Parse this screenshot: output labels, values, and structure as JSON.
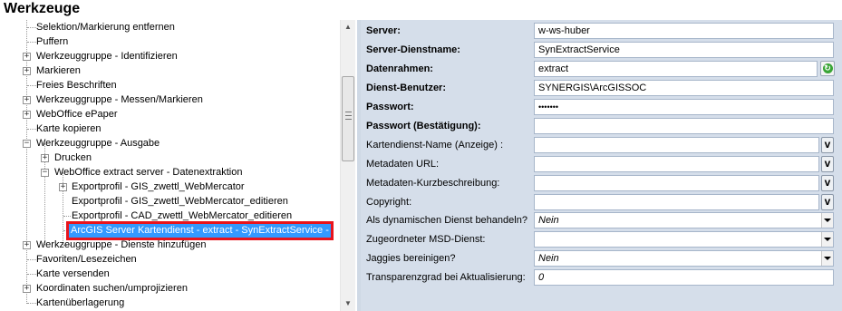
{
  "window": {
    "title": "Werkzeuge"
  },
  "tree": {
    "items": [
      {
        "label": "Selektion/Markierung entfernen",
        "toggle": ""
      },
      {
        "label": "Puffern",
        "toggle": ""
      },
      {
        "label": "Werkzeuggruppe - Identifizieren",
        "toggle": "+"
      },
      {
        "label": "Markieren",
        "toggle": "+"
      },
      {
        "label": "Freies Beschriften",
        "toggle": ""
      },
      {
        "label": "Werkzeuggruppe - Messen/Markieren",
        "toggle": "+"
      },
      {
        "label": "WebOffice ePaper",
        "toggle": "+"
      },
      {
        "label": "Karte kopieren",
        "toggle": ""
      },
      {
        "label": "Werkzeuggruppe - Ausgabe",
        "toggle": "−"
      },
      {
        "label": "Drucken",
        "toggle": "+"
      },
      {
        "label": "WebOffice extract server - Datenextraktion",
        "toggle": "−"
      },
      {
        "label": "Exportprofil - GIS_zwettl_WebMercator",
        "toggle": "+"
      },
      {
        "label": "Exportprofil - GIS_zwettl_WebMercator_editieren",
        "toggle": ""
      },
      {
        "label": "Exportprofil - CAD_zwettl_WebMercator_editieren",
        "toggle": ""
      },
      {
        "label": "ArcGIS Server Kartendienst - extract - SynExtractService -",
        "toggle": ""
      },
      {
        "label": "Werkzeuggruppe - Dienste hinzufügen",
        "toggle": "+"
      },
      {
        "label": "Favoriten/Lesezeichen",
        "toggle": ""
      },
      {
        "label": "Karte versenden",
        "toggle": ""
      },
      {
        "label": "Koordinaten suchen/umprojizieren",
        "toggle": "+"
      },
      {
        "label": "Kartenüberlagerung",
        "toggle": ""
      }
    ]
  },
  "scrollbar": {
    "up": "▲",
    "down": "▼"
  },
  "properties": {
    "rows": [
      {
        "label": "Server:",
        "value": "w-ws-huber",
        "bold": true,
        "control": "none"
      },
      {
        "label": "Server-Dienstname:",
        "value": "SynExtractService",
        "bold": true,
        "control": "none"
      },
      {
        "label": "Datenrahmen:",
        "value": "extract",
        "bold": true,
        "control": "refresh"
      },
      {
        "label": "Dienst-Benutzer:",
        "value": "SYNERGIS\\ArcGISSOC",
        "bold": true,
        "control": "none"
      },
      {
        "label": "Passwort:",
        "value": "•••••••",
        "bold": true,
        "control": "none"
      },
      {
        "label": "Passwort (Bestätigung):",
        "value": "",
        "bold": true,
        "control": "none"
      },
      {
        "label": "Kartendienst-Name (Anzeige) :",
        "value": "",
        "bold": false,
        "control": "v"
      },
      {
        "label": "Metadaten URL:",
        "value": "",
        "bold": false,
        "control": "v"
      },
      {
        "label": "Metadaten-Kurzbeschreibung:",
        "value": "",
        "bold": false,
        "control": "v"
      },
      {
        "label": "Copyright:",
        "value": "",
        "bold": false,
        "control": "v"
      },
      {
        "label": "Als dynamischen Dienst behandeln?",
        "value": "Nein",
        "bold": false,
        "control": "dropdown"
      },
      {
        "label": "Zugeordneter MSD-Dienst:",
        "value": "",
        "bold": false,
        "control": "dropdown"
      },
      {
        "label": "Jaggies bereinigen?",
        "value": "Nein",
        "bold": false,
        "control": "dropdown"
      },
      {
        "label": "Transparenzgrad bei Aktualisierung:",
        "value": "0",
        "bold": false,
        "control": "none"
      }
    ],
    "v_button_label": "v",
    "refresh_icon": "↻"
  },
  "colors": {
    "selection": "#3399ff",
    "highlight_box": "#e8141c",
    "panel": "#d5deea"
  }
}
